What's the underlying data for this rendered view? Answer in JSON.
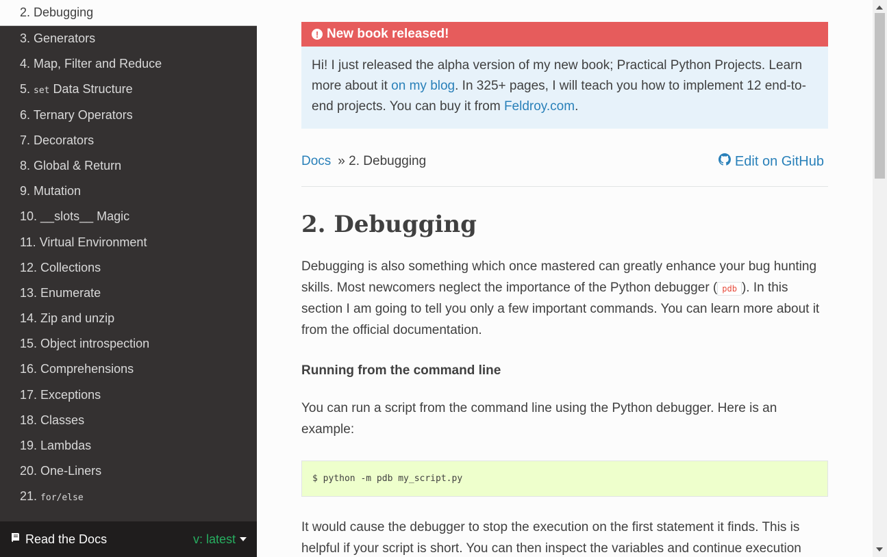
{
  "sidebar": {
    "items": [
      {
        "num": "2.",
        "label": "Debugging",
        "code": "",
        "current": true
      },
      {
        "num": "3.",
        "label": "Generators",
        "code": ""
      },
      {
        "num": "4.",
        "label": "Map, Filter and Reduce",
        "code": ""
      },
      {
        "num": "5.",
        "label": "Data Structure",
        "code": "set"
      },
      {
        "num": "6.",
        "label": "Ternary Operators",
        "code": ""
      },
      {
        "num": "7.",
        "label": "Decorators",
        "code": ""
      },
      {
        "num": "8.",
        "label": "Global & Return",
        "code": ""
      },
      {
        "num": "9.",
        "label": "Mutation",
        "code": ""
      },
      {
        "num": "10.",
        "label": "__slots__ Magic",
        "code": ""
      },
      {
        "num": "11.",
        "label": "Virtual Environment",
        "code": ""
      },
      {
        "num": "12.",
        "label": "Collections",
        "code": ""
      },
      {
        "num": "13.",
        "label": "Enumerate",
        "code": ""
      },
      {
        "num": "14.",
        "label": "Zip and unzip",
        "code": ""
      },
      {
        "num": "15.",
        "label": "Object introspection",
        "code": ""
      },
      {
        "num": "16.",
        "label": "Comprehensions",
        "code": ""
      },
      {
        "num": "17.",
        "label": "Exceptions",
        "code": ""
      },
      {
        "num": "18.",
        "label": "Classes",
        "code": ""
      },
      {
        "num": "19.",
        "label": "Lambdas",
        "code": ""
      },
      {
        "num": "20.",
        "label": "One-Liners",
        "code": ""
      },
      {
        "num": "21.",
        "label": "",
        "code": "for/else"
      }
    ],
    "footer": {
      "brand": "Read the Docs",
      "version": "v: latest",
      "brand_icon": "book-icon"
    }
  },
  "notice": {
    "title": "New book released!",
    "body_1": "Hi! I just released the alpha version of my new book; Practical Python Projects. Learn more about it ",
    "link_1": "on my blog",
    "body_2": ". In 325+ pages, I will teach you how to implement 12 end-to-end projects. You can buy it from ",
    "link_2": "Feldroy.com",
    "body_3": "."
  },
  "breadcrumbs": {
    "home": "Docs",
    "separator": "»",
    "current": "2. Debugging",
    "edit": "Edit on GitHub"
  },
  "content": {
    "heading": "2. Debugging",
    "intro_1": "Debugging is also something which once mastered can greatly enhance your bug hunting skills. Most newcomers neglect the importance of the Python debugger (",
    "intro_code": "pdb",
    "intro_2": "). In this section I am going to tell you only a few important commands. You can learn more about it from the official documentation.",
    "subheading": "Running from the command line",
    "para_2": "You can run a script from the command line using the Python debugger. Here is an example:",
    "code_block": "$ python -m pdb my_script.py",
    "para_3": "It would cause the debugger to stop the execution on the first statement it finds. This is helpful if your script is short. You can then inspect the variables and continue execution"
  },
  "colors": {
    "sidebar_bg": "#343131",
    "notice_title_bg": "#e65c5c",
    "notice_body_bg": "#e7f2fa",
    "link": "#2980b9",
    "version": "#27ae60",
    "code_bg": "#eeffcc"
  }
}
